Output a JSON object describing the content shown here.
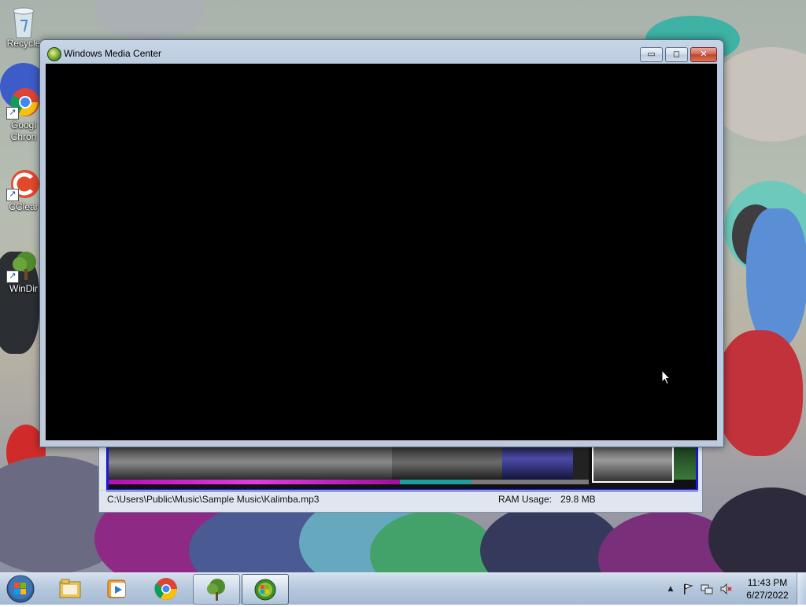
{
  "desktop": {
    "icons": [
      {
        "label": "Recycle",
        "icon": "recycle-bin-icon"
      },
      {
        "label": "Googl Chron",
        "icon": "chrome-icon"
      },
      {
        "label": "CClear",
        "icon": "ccleaner-icon"
      },
      {
        "label": "WinDir",
        "icon": "windirstat-icon"
      }
    ]
  },
  "wmc_window": {
    "title": "Windows Media Center",
    "minimize_glyph": "▭",
    "maximize_glyph": "◻",
    "close_glyph": "✕"
  },
  "windirstat_window": {
    "path": "C:\\Users\\Public\\Music\\Sample Music\\Kalimba.mp3",
    "ram_label": "RAM Usage:",
    "ram_value": "29.8 MB"
  },
  "taskbar": {
    "buttons": [
      {
        "name": "windows-explorer",
        "icon": "folder-icon",
        "state": "pinned"
      },
      {
        "name": "windows-media-player",
        "icon": "media-player-icon",
        "state": "pinned"
      },
      {
        "name": "google-chrome",
        "icon": "chrome-icon",
        "state": "pinned"
      },
      {
        "name": "windirstat",
        "icon": "windirstat-icon",
        "state": "open"
      },
      {
        "name": "windows-media-center",
        "icon": "media-center-icon",
        "state": "active"
      }
    ],
    "tray": {
      "show_hidden_glyph": "▲",
      "time": "11:43 PM",
      "date": "6/27/2022"
    }
  },
  "colors": {
    "wmc_client": "#000000",
    "treemap_border": "#1a1ad8",
    "taskbar": "#b0c4da"
  }
}
